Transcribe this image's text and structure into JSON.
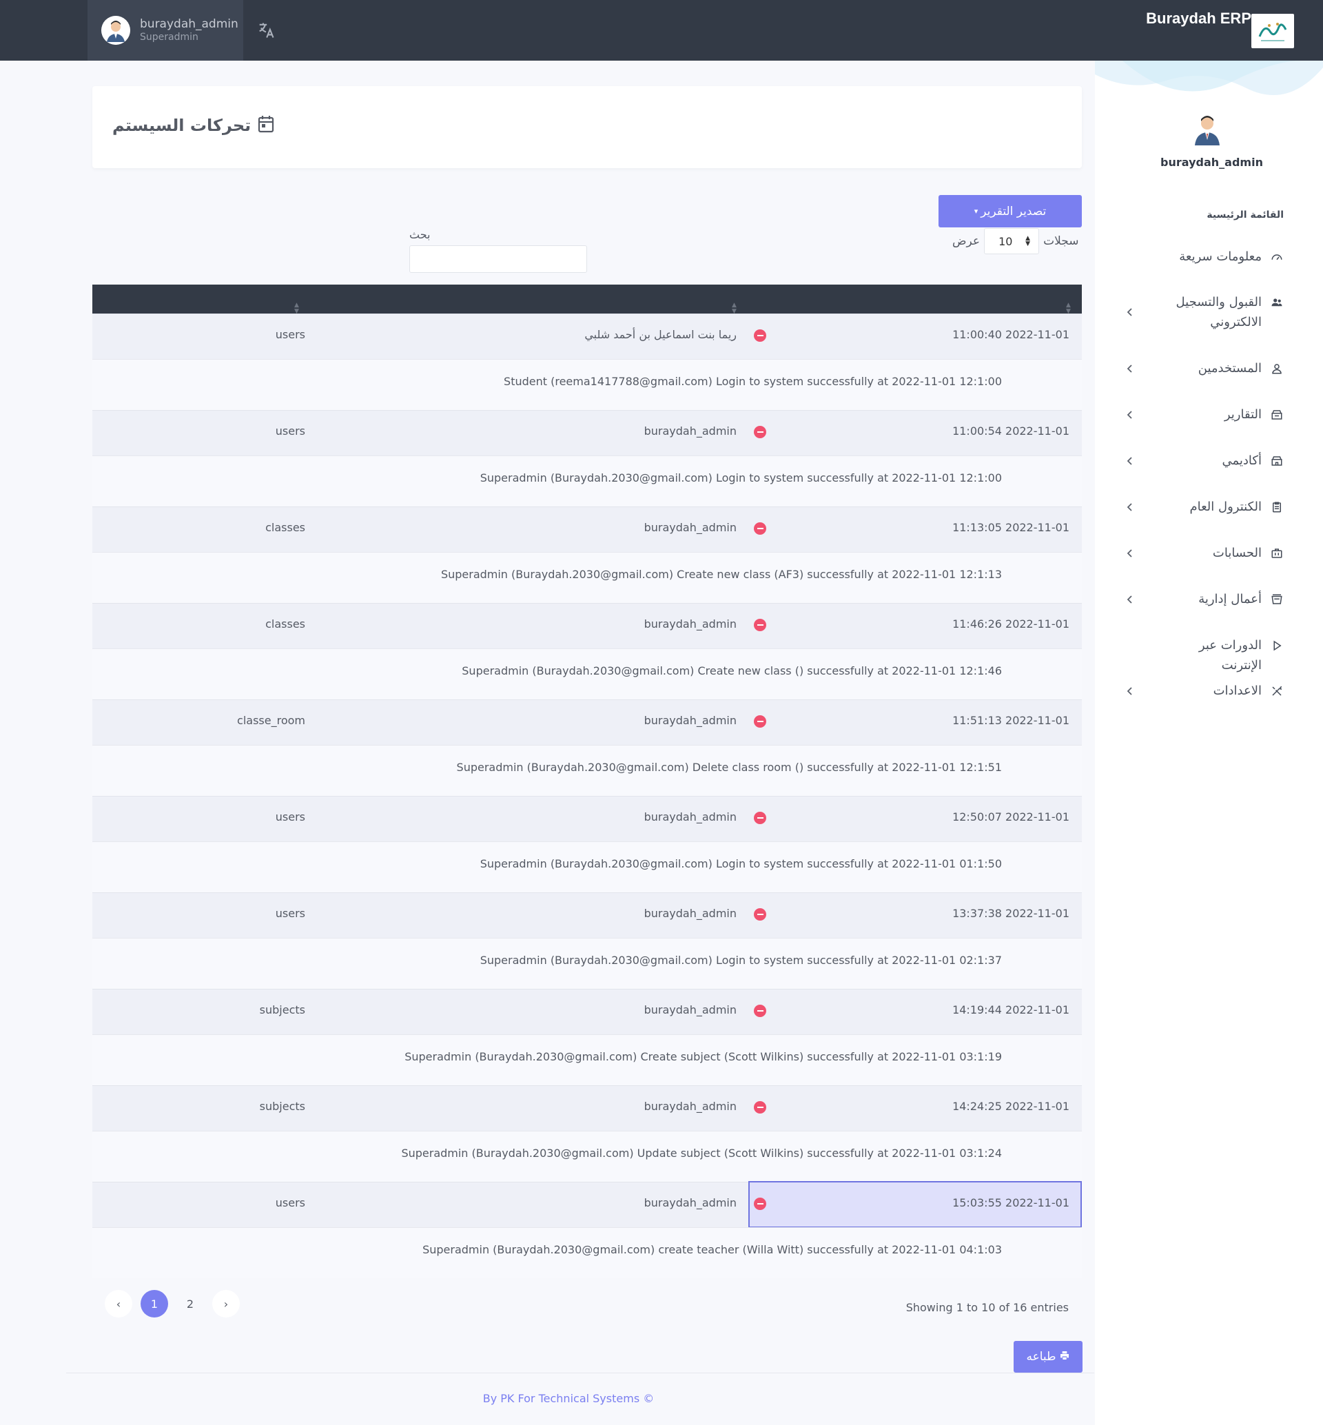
{
  "topbar": {
    "brand": "Buraydah ERP",
    "user_name": "buraydah_admin",
    "user_role": "Superadmin"
  },
  "sidebar": {
    "user": "buraydah_admin",
    "menu_head": "القائمة الرئيسية",
    "items": [
      {
        "label": "معلومات سريعة",
        "icon": "speedometer-icon"
      },
      {
        "label": "القبول والتسجيل الالكتروني",
        "icon": "users-icon"
      },
      {
        "label": "المستخدمين",
        "icon": "user-icon"
      },
      {
        "label": "التقارير",
        "icon": "reports-icon"
      },
      {
        "label": "أكاديمي",
        "icon": "academic-icon"
      },
      {
        "label": "الكنترول العام",
        "icon": "clipboard-icon"
      },
      {
        "label": "الحسابات",
        "icon": "briefcase-icon"
      },
      {
        "label": "أعمال إدارية",
        "icon": "admin-icon"
      },
      {
        "label": "الدورات عبر الإنترنت",
        "icon": "play-icon"
      },
      {
        "label": "الاعدادات",
        "icon": "tools-icon"
      }
    ]
  },
  "page": {
    "title": "تحركات السيستم"
  },
  "controls": {
    "export_label": "تصدير التقرير",
    "show_label": "عرض",
    "records_label": "سجلات",
    "page_length": "10",
    "search_label": "بحث",
    "search_value": ""
  },
  "rows": [
    {
      "date": "11:00:40 2022-11-01",
      "user": "ريما بنت اسماعيل بن أحمد شلبي",
      "table": "users",
      "detail": "Student (reema1417788@gmail.com) Login to system successfully at 2022-11-01 12:1:00"
    },
    {
      "date": "11:00:54 2022-11-01",
      "user": "buraydah_admin",
      "table": "users",
      "detail": "Superadmin (Buraydah.2030@gmail.com) Login to system successfully at 2022-11-01 12:1:00"
    },
    {
      "date": "11:13:05 2022-11-01",
      "user": "buraydah_admin",
      "table": "classes",
      "detail": "Superadmin (Buraydah.2030@gmail.com) Create new class (AF3) successfully at 2022-11-01 12:1:13"
    },
    {
      "date": "11:46:26 2022-11-01",
      "user": "buraydah_admin",
      "table": "classes",
      "detail": "Superadmin (Buraydah.2030@gmail.com) Create new class () successfully at 2022-11-01 12:1:46"
    },
    {
      "date": "11:51:13 2022-11-01",
      "user": "buraydah_admin",
      "table": "classe_room",
      "detail": "Superadmin (Buraydah.2030@gmail.com) Delete class room () successfully at 2022-11-01 12:1:51"
    },
    {
      "date": "12:50:07 2022-11-01",
      "user": "buraydah_admin",
      "table": "users",
      "detail": "Superadmin (Buraydah.2030@gmail.com) Login to system successfully at 2022-11-01 01:1:50"
    },
    {
      "date": "13:37:38 2022-11-01",
      "user": "buraydah_admin",
      "table": "users",
      "detail": "Superadmin (Buraydah.2030@gmail.com) Login to system successfully at 2022-11-01 02:1:37"
    },
    {
      "date": "14:19:44 2022-11-01",
      "user": "buraydah_admin",
      "table": "subjects",
      "detail": "Superadmin (Buraydah.2030@gmail.com) Create subject (Scott Wilkins) successfully at 2022-11-01 03:1:19"
    },
    {
      "date": "14:24:25 2022-11-01",
      "user": "buraydah_admin",
      "table": "subjects",
      "detail": "Superadmin (Buraydah.2030@gmail.com) Update subject (Scott Wilkins) successfully at 2022-11-01 03:1:24"
    },
    {
      "date": "15:03:55 2022-11-01",
      "user": "buraydah_admin",
      "table": "users",
      "detail": "Superadmin (Buraydah.2030@gmail.com) create teacher (Willa Witt) successfully at 2022-11-01 04:1:03"
    }
  ],
  "pagination": {
    "prev": "‹",
    "pages": [
      "1",
      "2"
    ],
    "next": "›",
    "info": "Showing 1 to 10 of 16 entries"
  },
  "print_label": "طباعه",
  "footer": "By PK For Technical Systems ©",
  "colors": {
    "navbar": "#333a46",
    "accent": "#7a7ff0",
    "danger": "#f0506e"
  }
}
